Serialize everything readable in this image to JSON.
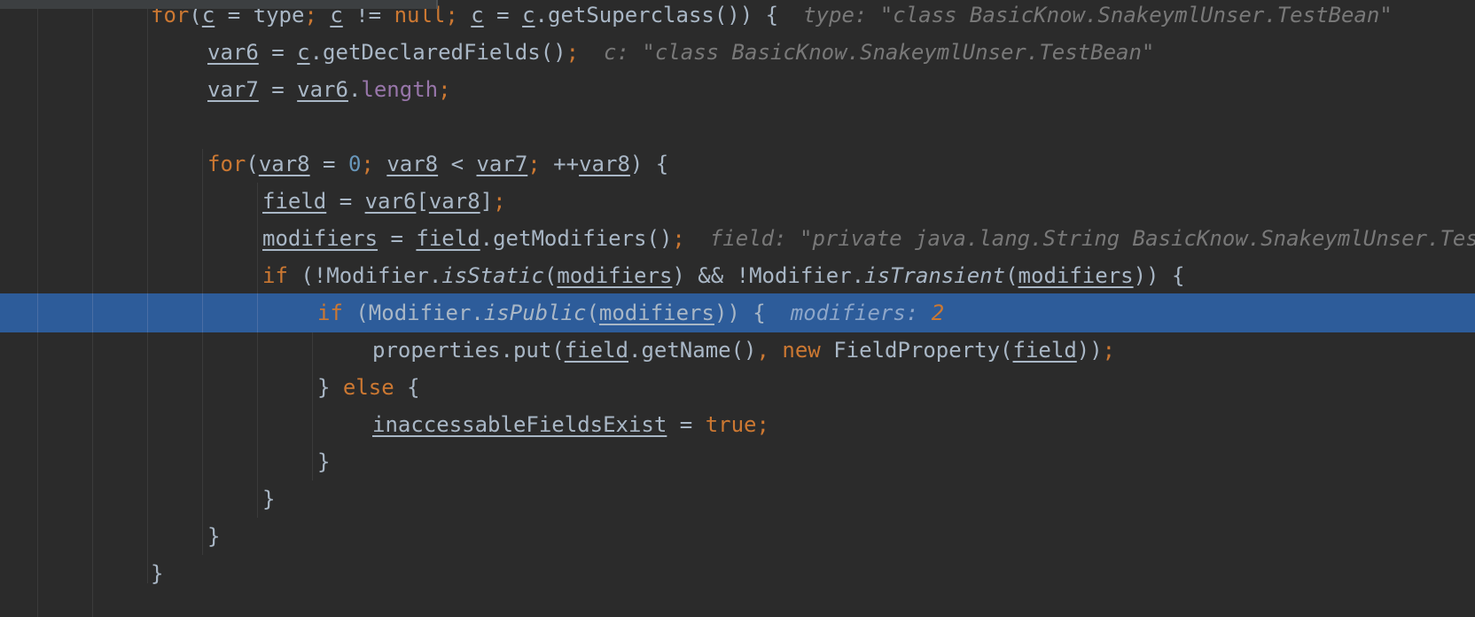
{
  "editor": {
    "lines": [
      {
        "id": "line-for-superclass",
        "tokens": [
          {
            "t": "for",
            "c": "kw"
          },
          {
            "t": "(",
            "c": ""
          },
          {
            "t": "c",
            "c": "u"
          },
          {
            "t": " = type",
            "c": ""
          },
          {
            "t": ";",
            "c": "kw"
          },
          {
            "t": " ",
            "c": ""
          },
          {
            "t": "c",
            "c": "u"
          },
          {
            "t": " != ",
            "c": ""
          },
          {
            "t": "null",
            "c": "kw"
          },
          {
            "t": ";",
            "c": "kw"
          },
          {
            "t": " ",
            "c": ""
          },
          {
            "t": "c",
            "c": "u"
          },
          {
            "t": " = ",
            "c": ""
          },
          {
            "t": "c",
            "c": "u"
          },
          {
            "t": ".getSuperclass()) {",
            "c": ""
          }
        ],
        "hint": "type: \"class BasicKnow.SnakeymlUnser.TestBean\""
      },
      {
        "id": "line-var6",
        "tokens": [
          {
            "t": "var6",
            "c": "u"
          },
          {
            "t": " = ",
            "c": ""
          },
          {
            "t": "c",
            "c": "u"
          },
          {
            "t": ".getDeclaredFields()",
            "c": ""
          },
          {
            "t": ";",
            "c": "kw"
          }
        ],
        "hint": "c: \"class BasicKnow.SnakeymlUnser.TestBean\""
      },
      {
        "id": "line-var7",
        "tokens": [
          {
            "t": "var7",
            "c": "u"
          },
          {
            "t": " = ",
            "c": ""
          },
          {
            "t": "var6",
            "c": "u"
          },
          {
            "t": ".",
            "c": ""
          },
          {
            "t": "length",
            "c": "fld"
          },
          {
            "t": ";",
            "c": "kw"
          }
        ]
      },
      {
        "id": "line-blank",
        "tokens": []
      },
      {
        "id": "line-for-var8",
        "tokens": [
          {
            "t": "for",
            "c": "kw"
          },
          {
            "t": "(",
            "c": ""
          },
          {
            "t": "var8",
            "c": "u"
          },
          {
            "t": " = ",
            "c": ""
          },
          {
            "t": "0",
            "c": "num"
          },
          {
            "t": ";",
            "c": "kw"
          },
          {
            "t": " ",
            "c": ""
          },
          {
            "t": "var8",
            "c": "u"
          },
          {
            "t": " < ",
            "c": ""
          },
          {
            "t": "var7",
            "c": "u"
          },
          {
            "t": ";",
            "c": "kw"
          },
          {
            "t": " ++",
            "c": ""
          },
          {
            "t": "var8",
            "c": "u"
          },
          {
            "t": ") {",
            "c": ""
          }
        ]
      },
      {
        "id": "line-field-assign",
        "tokens": [
          {
            "t": "field",
            "c": "u"
          },
          {
            "t": " = ",
            "c": ""
          },
          {
            "t": "var6",
            "c": "u"
          },
          {
            "t": "[",
            "c": ""
          },
          {
            "t": "var8",
            "c": "u"
          },
          {
            "t": "]",
            "c": ""
          },
          {
            "t": ";",
            "c": "kw"
          }
        ]
      },
      {
        "id": "line-modifiers-assign",
        "tokens": [
          {
            "t": "modifiers",
            "c": "u"
          },
          {
            "t": " = ",
            "c": ""
          },
          {
            "t": "field",
            "c": "u"
          },
          {
            "t": ".getModifiers()",
            "c": ""
          },
          {
            "t": ";",
            "c": "kw"
          }
        ],
        "hint": "field: \"private java.lang.String BasicKnow.SnakeymlUnser.TestBean.name\""
      },
      {
        "id": "line-if-static",
        "tokens": [
          {
            "t": "if",
            "c": "kw"
          },
          {
            "t": " (!Modifier.",
            "c": ""
          },
          {
            "t": "isStatic",
            "c": "it"
          },
          {
            "t": "(",
            "c": ""
          },
          {
            "t": "modifiers",
            "c": "u"
          },
          {
            "t": ") && !Modifier.",
            "c": ""
          },
          {
            "t": "isTransient",
            "c": "it"
          },
          {
            "t": "(",
            "c": ""
          },
          {
            "t": "modifiers",
            "c": "u"
          },
          {
            "t": ")) {",
            "c": ""
          }
        ]
      },
      {
        "id": "line-if-public",
        "tokens": [
          {
            "t": "if",
            "c": "kw"
          },
          {
            "t": " (Modifier.",
            "c": ""
          },
          {
            "t": "isPublic",
            "c": "it"
          },
          {
            "t": "(",
            "c": ""
          },
          {
            "t": "modifiers",
            "c": "u"
          },
          {
            "t": ")) {",
            "c": ""
          }
        ],
        "hint": "modifiers: ",
        "hint_value": "2"
      },
      {
        "id": "line-properties-put",
        "tokens": [
          {
            "t": "properties.put(",
            "c": ""
          },
          {
            "t": "field",
            "c": "u"
          },
          {
            "t": ".getName()",
            "c": ""
          },
          {
            "t": ",",
            "c": "kw"
          },
          {
            "t": " ",
            "c": ""
          },
          {
            "t": "new",
            "c": "kw"
          },
          {
            "t": " FieldProperty(",
            "c": ""
          },
          {
            "t": "field",
            "c": "u"
          },
          {
            "t": "))",
            "c": ""
          },
          {
            "t": ";",
            "c": "kw"
          }
        ]
      },
      {
        "id": "line-else",
        "tokens": [
          {
            "t": "} ",
            "c": ""
          },
          {
            "t": "else",
            "c": "kw"
          },
          {
            "t": " {",
            "c": ""
          }
        ]
      },
      {
        "id": "line-inaccessable",
        "tokens": [
          {
            "t": "inaccessableFieldsExist",
            "c": "u"
          },
          {
            "t": " = ",
            "c": ""
          },
          {
            "t": "true",
            "c": "kw"
          },
          {
            "t": ";",
            "c": "kw"
          }
        ]
      },
      {
        "id": "line-close-else",
        "tokens": [
          {
            "t": "}",
            "c": ""
          }
        ]
      },
      {
        "id": "line-close-if-static",
        "tokens": [
          {
            "t": "}",
            "c": ""
          }
        ]
      },
      {
        "id": "line-close-for-var8",
        "tokens": [
          {
            "t": "}",
            "c": ""
          }
        ]
      },
      {
        "id": "line-close-for-super",
        "tokens": [
          {
            "t": "}",
            "c": ""
          }
        ]
      }
    ]
  },
  "colors": {
    "background": "#2b2b2b",
    "current_line": "#2d5c9a",
    "keyword": "#cc7832",
    "number": "#6897bb",
    "field": "#9876aa",
    "text": "#a9b7c6",
    "hint": "#787878"
  }
}
